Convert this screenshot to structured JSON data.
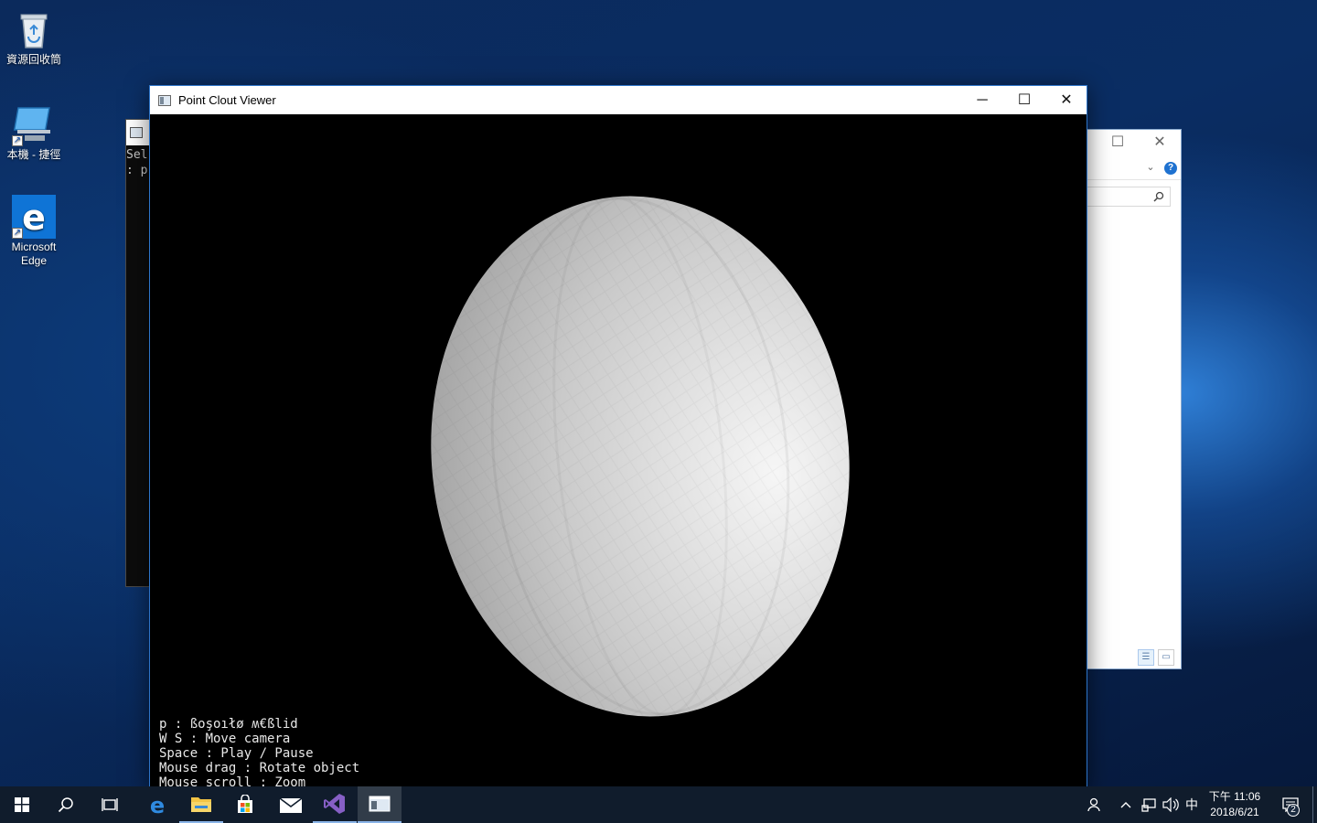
{
  "desktop": {
    "icons": [
      {
        "label": "資源回收筒",
        "icon": "recycle-bin-icon"
      },
      {
        "label": "本機 - 捷徑",
        "icon": "computer-icon"
      },
      {
        "label": "Microsoft Edge",
        "icon": "edge-icon"
      }
    ]
  },
  "console_window": {
    "lines": [
      "Sel",
      ": p"
    ]
  },
  "main_window": {
    "title": "Point Clout Viewer",
    "controls": {
      "minimize": "─",
      "maximize": "☐",
      "close": "✕"
    },
    "help_lines": [
      "p : ßoşoıłø ʍ€ßlid",
      "W S : Move camera",
      "Space : Play / Pause",
      "Mouse drag : Rotate object",
      "Mouse scroll : Zoom"
    ]
  },
  "explorer_window": {
    "controls": {
      "maximize": "☐",
      "close": "✕"
    }
  },
  "taskbar": {
    "apps": [
      "start-icon",
      "search-icon",
      "task-view-icon",
      "edge-icon",
      "file-explorer-icon",
      "store-icon",
      "mail-icon",
      "visual-studio-icon",
      "point-viewer-icon"
    ],
    "tray": {
      "ime": "中"
    },
    "clock": {
      "time": "下午 11:06",
      "date": "2018/6/21"
    },
    "notifications": "2"
  }
}
